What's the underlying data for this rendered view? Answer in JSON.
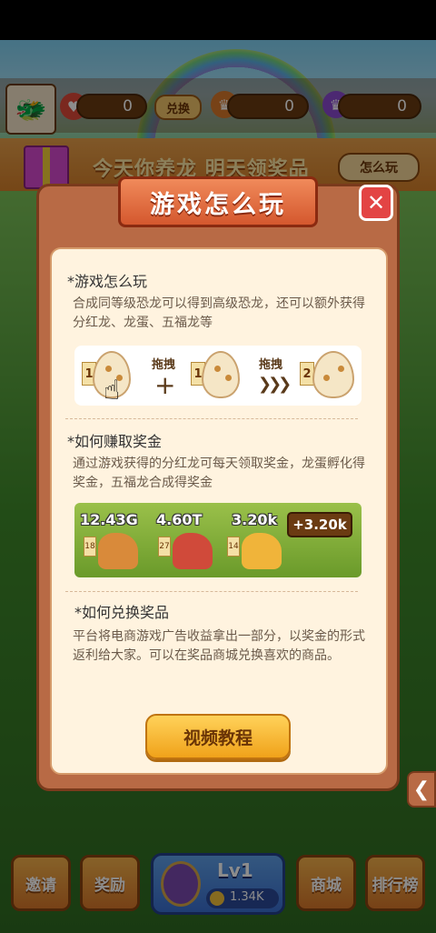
{
  "header": {
    "avatar_icon": "avatar-icon",
    "counters": [
      {
        "icon": "heart-coin-icon",
        "value": "0"
      },
      {
        "icon": "gold-dragon-icon",
        "value": "0"
      },
      {
        "icon": "purple-dragon-icon",
        "value": "0"
      }
    ],
    "redeem_label": "兑换"
  },
  "banner": {
    "text": "今天你养龙  明天领奖品",
    "how_to_play_label": "怎么玩"
  },
  "bottom_bar": {
    "invite_label": "邀请",
    "reward_label": "奖励",
    "level_label": "Lv1",
    "coin_value": "1.34K",
    "shop_label": "商城",
    "ranking_label": "排行榜"
  },
  "modal": {
    "title": "游戏怎么玩",
    "close_icon": "close-icon",
    "section1": {
      "heading": "*游戏怎么玩",
      "body": "合成同等级恐龙可以得到高级恐龙，还可以额外获得分红龙、龙蛋、五福龙等",
      "egg_level_1": "1",
      "egg_level_2": "1",
      "egg_level_3": "2",
      "drag_label_1": "拖拽",
      "drag_label_2": "拖拽"
    },
    "section2": {
      "heading": "*如何赚取奖金",
      "body": "通过游戏获得的分红龙可每天领取奖金，龙蛋孵化得奖金，五福龙合成得奖金",
      "values": [
        "12.43G",
        "4.60T",
        "3.20k"
      ],
      "levels": [
        "18",
        "27",
        "14"
      ],
      "gain_badge": "+3.20k"
    },
    "section3": {
      "heading": "*如何兑换奖品",
      "body": "平台将电商游戏广告收益拿出一部分，以奖金的形式返利给大家。可以在奖品商城兑换喜欢的商品。"
    },
    "video_button_label": "视频教程"
  },
  "colors": {
    "modal_frame": "#b86a45",
    "modal_inner": "#fff3df",
    "title_ribbon": "#e2703e",
    "close_button": "#e34444",
    "video_button": "#f6b832"
  }
}
